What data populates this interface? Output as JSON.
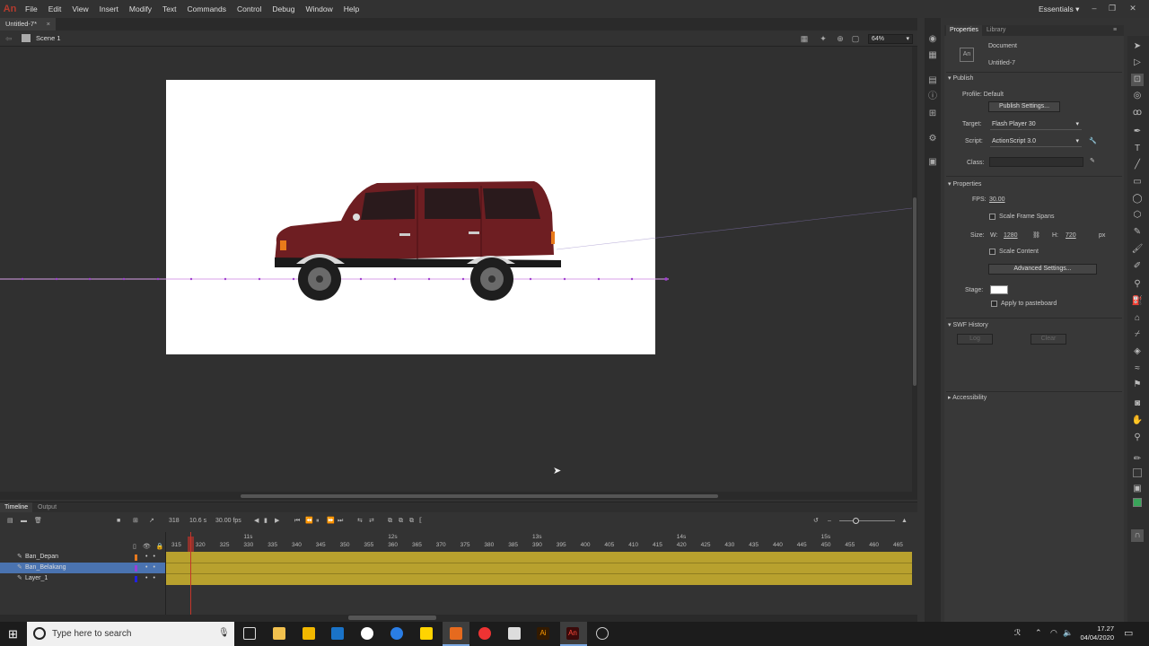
{
  "menubar": {
    "logo": "An",
    "items": [
      "File",
      "Edit",
      "View",
      "Insert",
      "Modify",
      "Text",
      "Commands",
      "Control",
      "Debug",
      "Window",
      "Help"
    ],
    "workspace": "Essentials ▾"
  },
  "document": {
    "tab": "Untitled-7*",
    "close": "×",
    "scene": "Scene 1",
    "zoom": "64%",
    "zoom_arrow": "▾"
  },
  "timeline": {
    "tabs": [
      "Timeline",
      "Output"
    ],
    "current_frame": "318",
    "elapsed": "10.6 s",
    "fps": "30.00 fps",
    "second_labels": [
      {
        "frame": 330,
        "label": "11s"
      },
      {
        "frame": 360,
        "label": "12s"
      },
      {
        "frame": 390,
        "label": "13s"
      },
      {
        "frame": 420,
        "label": "14s"
      },
      {
        "frame": 450,
        "label": "15s"
      }
    ],
    "frame_start": 315,
    "frame_end": 465,
    "frame_step": 5,
    "layers": [
      {
        "name": "Ban_Depan",
        "color": "#e6781e",
        "selected": false
      },
      {
        "name": "Ban_Belakang",
        "color": "#9a3fd8",
        "selected": true
      },
      {
        "name": "Layer_1",
        "color": "#2020e0",
        "selected": false
      }
    ]
  },
  "properties": {
    "tabs": [
      "Properties",
      "Library"
    ],
    "doc_type": "Document",
    "doc_name": "Untitled-7",
    "publish": {
      "header": "Publish",
      "profile_label": "Profile:",
      "profile_value": "Default",
      "settings_button": "Publish Settings...",
      "target_label": "Target:",
      "target_value": "Flash Player 30",
      "script_label": "Script:",
      "script_value": "ActionScript 3.0",
      "class_label": "Class:"
    },
    "props": {
      "header": "Properties",
      "fps_label": "FPS:",
      "fps_value": "30.00",
      "scale_spans": "Scale Frame Spans",
      "size_label": "Size:",
      "w_label": "W:",
      "w_value": "1280",
      "h_label": "H:",
      "h_value": "720",
      "unit": "px",
      "scale_content": "Scale Content",
      "advanced_button": "Advanced Settings...",
      "stage_label": "Stage:",
      "stage_color": "#ffffff",
      "apply_paste": "Apply to pasteboard"
    },
    "swf": {
      "header": "SWF History",
      "log": "Log",
      "clear": "Clear"
    },
    "accessibility": "Accessibility"
  },
  "taskbar": {
    "search_placeholder": "Type here to search",
    "time": "17.27",
    "date": "04/04/2020"
  },
  "colors": {
    "car_body": "#6e1e22",
    "tween_path": "#c060e0"
  }
}
